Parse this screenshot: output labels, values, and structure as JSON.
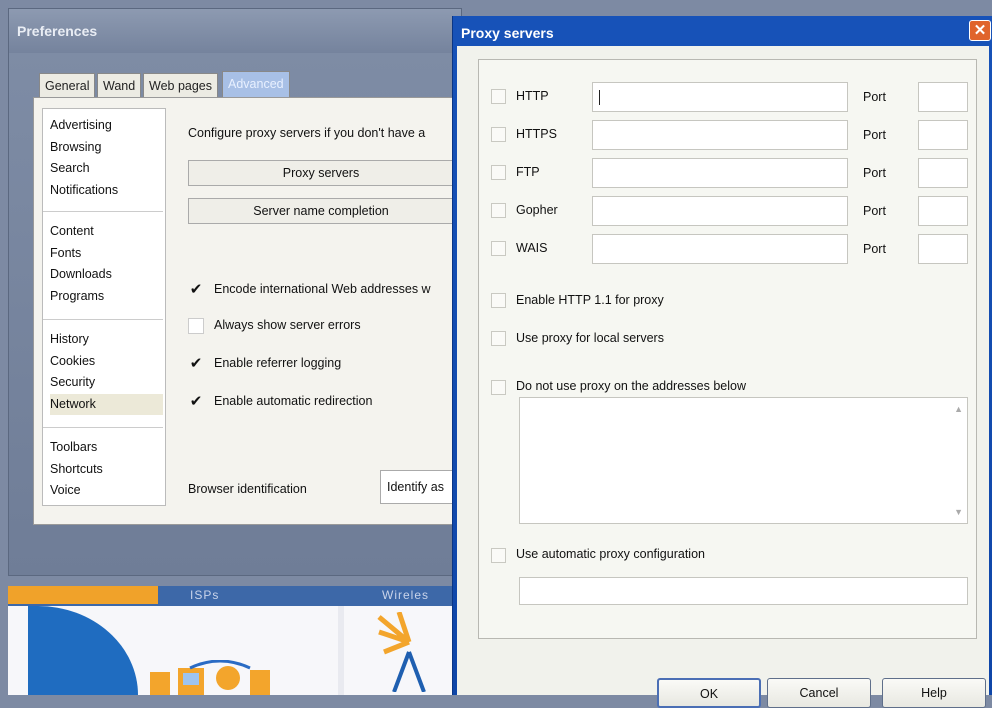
{
  "preferences": {
    "title": "Preferences",
    "tabs": [
      "General",
      "Wand",
      "Web pages",
      "Advanced"
    ],
    "active_tab": "Advanced",
    "list_groups": [
      [
        "Advertising",
        "Browsing",
        "Search",
        "Notifications"
      ],
      [
        "Content",
        "Fonts",
        "Downloads",
        "Programs"
      ],
      [
        "History",
        "Cookies",
        "Security",
        "Network"
      ],
      [
        "Toolbars",
        "Shortcuts",
        "Voice"
      ]
    ],
    "selected_item": "Network",
    "proxy_intro": "Configure proxy servers if you don't have a",
    "proxy_servers_button": "Proxy servers",
    "server_name_button": "Server name completion",
    "options": [
      {
        "label": "Encode international Web addresses w",
        "checked": true
      },
      {
        "label": "Always show server errors",
        "checked": false
      },
      {
        "label": "Enable referrer logging",
        "checked": true
      },
      {
        "label": "Enable automatic redirection",
        "checked": true
      }
    ],
    "browser_identification_label": "Browser identification",
    "browser_identification_value": "Identify as"
  },
  "background_page": {
    "tab1": "ISPs",
    "tab2": "Wireles"
  },
  "dialog": {
    "title": "Proxy servers",
    "close_glyph": "✕",
    "protocols": [
      {
        "name": "HTTP",
        "port_label": "Port",
        "checked": false,
        "value": ""
      },
      {
        "name": "HTTPS",
        "port_label": "Port",
        "checked": false,
        "value": ""
      },
      {
        "name": "FTP",
        "port_label": "Port",
        "checked": false,
        "value": ""
      },
      {
        "name": "Gopher",
        "port_label": "Port",
        "checked": false,
        "value": ""
      },
      {
        "name": "WAIS",
        "port_label": "Port",
        "checked": false,
        "value": ""
      }
    ],
    "enable_http11": "Enable HTTP 1.1 for proxy",
    "use_local": "Use proxy for local servers",
    "no_proxy": "Do not use proxy on the addresses below",
    "auto_config": "Use automatic proxy configuration",
    "buttons": {
      "ok": "OK",
      "cancel": "Cancel",
      "help": "Help"
    }
  },
  "colors": {
    "dialog_titlebar": "#1752b8",
    "close_button": "#e0642c",
    "active_tab": "#a8c0e6"
  }
}
